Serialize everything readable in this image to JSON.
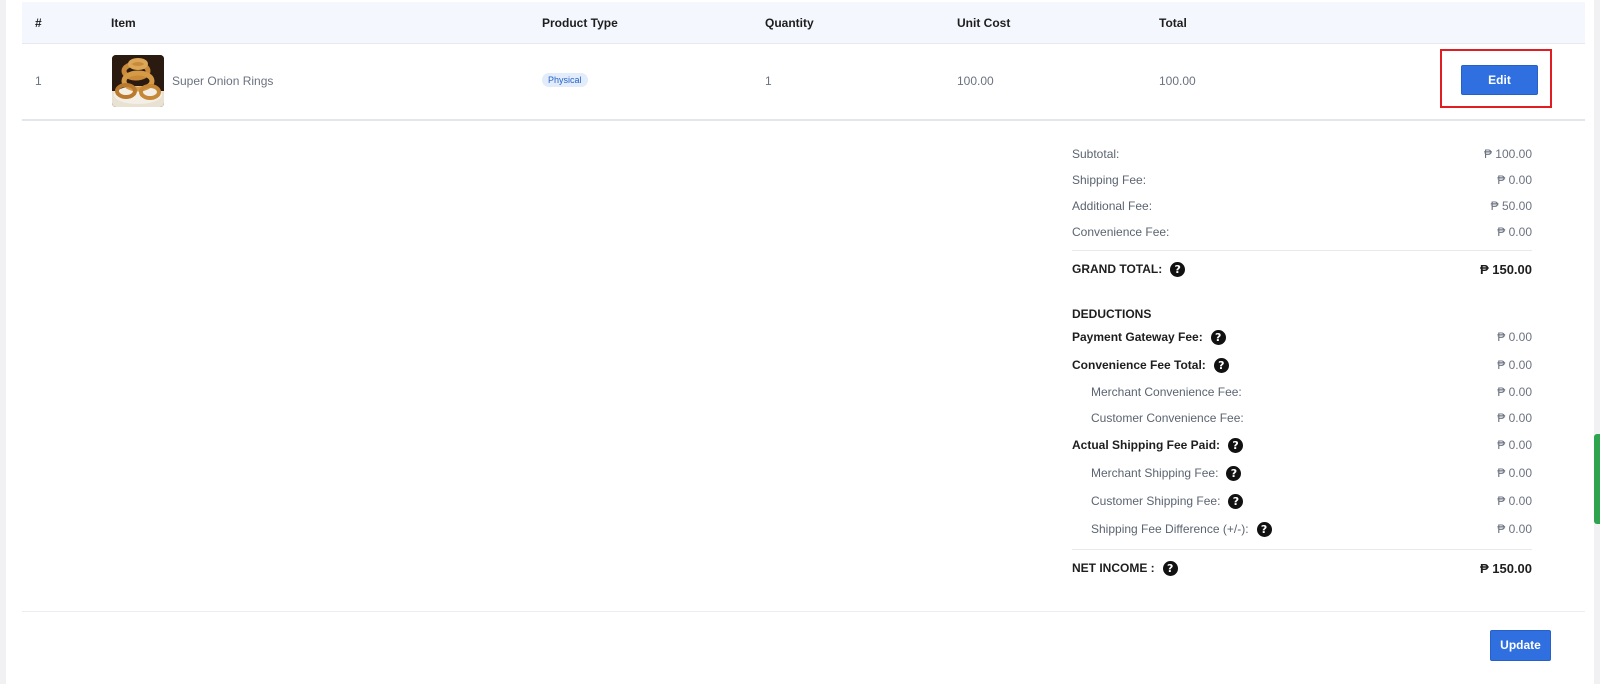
{
  "table": {
    "headers": {
      "index": "#",
      "item": "Item",
      "product_type": "Product Type",
      "quantity": "Quantity",
      "unit_cost": "Unit Cost",
      "total": "Total"
    },
    "rows": [
      {
        "index": "1",
        "item_name": "Super Onion Rings",
        "product_type": "Physical",
        "quantity": "1",
        "unit_cost": "100.00",
        "total": "100.00",
        "action_label": "Edit"
      }
    ]
  },
  "summary": {
    "subtotal": {
      "label": "Subtotal:",
      "value": "₱ 100.00"
    },
    "shipping_fee": {
      "label": "Shipping Fee:",
      "value": "₱ 0.00"
    },
    "additional_fee": {
      "label": "Additional Fee:",
      "value": "₱ 50.00"
    },
    "convenience_fee": {
      "label": "Convenience Fee:",
      "value": "₱ 0.00"
    },
    "grand_total": {
      "label": "GRAND TOTAL:",
      "value": "₱ 150.00"
    },
    "deductions_title": "DEDUCTIONS",
    "payment_gateway_fee": {
      "label": "Payment Gateway Fee:",
      "value": "₱ 0.00"
    },
    "convenience_fee_total": {
      "label": "Convenience Fee Total:",
      "value": "₱ 0.00"
    },
    "merchant_convenience_fee": {
      "label": "Merchant Convenience Fee:",
      "value": "₱ 0.00"
    },
    "customer_convenience_fee": {
      "label": "Customer Convenience Fee:",
      "value": "₱ 0.00"
    },
    "actual_shipping_fee_paid": {
      "label": "Actual Shipping Fee Paid:",
      "value": "₱ 0.00"
    },
    "merchant_shipping_fee": {
      "label": "Merchant Shipping Fee:",
      "value": "₱ 0.00"
    },
    "customer_shipping_fee": {
      "label": "Customer Shipping Fee:",
      "value": "₱ 0.00"
    },
    "shipping_fee_difference": {
      "label": "Shipping Fee Difference (+/-):",
      "value": "₱ 0.00"
    },
    "net_income": {
      "label": "NET INCOME :",
      "value": "₱ 150.00"
    }
  },
  "help_glyph": "?",
  "update_label": "Update",
  "colors": {
    "primary": "#2f6fe0",
    "highlight": "#e11d24",
    "header_bg": "#f4f7fd"
  }
}
